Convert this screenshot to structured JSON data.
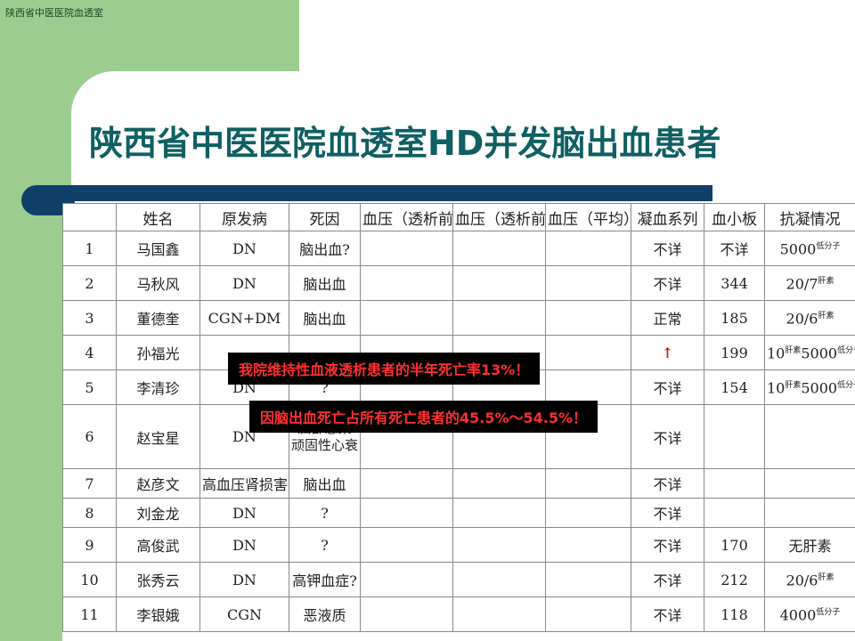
{
  "header": {
    "org": "陕西省中医医院血透室"
  },
  "title": "陕西省中医医院血透室HD并发脑出血患者",
  "table": {
    "columns": [
      "",
      "姓名",
      "原发病",
      "死因",
      "血压（透析前）",
      "血压（透析前）",
      "血压（平均）",
      "凝血系列",
      "血小板",
      "抗凝情况"
    ],
    "rows": [
      {
        "no": "1",
        "name": "马国鑫",
        "disease": "DN",
        "cause": "脑出血?",
        "coag": "不详",
        "plt": "不详",
        "anti": "5000",
        "anti_sup": "低分子"
      },
      {
        "no": "2",
        "name": "马秋风",
        "disease": "DN",
        "cause": "脑出血",
        "coag": "不详",
        "plt": "344",
        "anti": "20/7",
        "anti_sup": "肝素"
      },
      {
        "no": "3",
        "name": "董德奎",
        "disease": "CGN+DM",
        "cause": "脑出血",
        "coag": "正常",
        "plt": "185",
        "anti": "20/6",
        "anti_sup": "肝素"
      },
      {
        "no": "4",
        "name": "孙福光",
        "disease": "",
        "cause": "",
        "coag": "",
        "plt": "199",
        "anti": "10",
        "anti_sup": "肝素",
        "anti2": "5000",
        "anti2_sup": "低分子"
      },
      {
        "no": "5",
        "name": "李清珍",
        "disease": "DN",
        "cause": "?",
        "coag": "不详",
        "plt": "154",
        "anti": "10",
        "anti_sup": "肝素",
        "anti2": "5000",
        "anti2_sup": "低分子"
      },
      {
        "no": "6",
        "name": "赵宝星",
        "disease": "DN",
        "cause": "脑部感染",
        "cause2": "顽固性心衰",
        "coag": "不详",
        "plt": "",
        "anti": ""
      },
      {
        "no": "7",
        "name": "赵彦文",
        "disease": "高血压肾损害",
        "cause": "脑出血",
        "coag": "不详",
        "plt": "",
        "anti": ""
      },
      {
        "no": "8",
        "name": "刘金龙",
        "disease": "DN",
        "cause": "?",
        "coag": "不详",
        "plt": "",
        "anti": ""
      },
      {
        "no": "9",
        "name": "高俊武",
        "disease": "DN",
        "cause": "?",
        "coag": "不详",
        "plt": "170",
        "anti": "无肝素"
      },
      {
        "no": "10",
        "name": "张秀云",
        "disease": "DN",
        "cause": "高钾血症?",
        "coag": "不详",
        "plt": "212",
        "anti": "20/6",
        "anti_sup": "肝素"
      },
      {
        "no": "11",
        "name": "李银娥",
        "disease": "CGN",
        "cause": "恶液质",
        "coag": "不详",
        "plt": "118",
        "anti": "4000",
        "anti_sup": "低分子"
      }
    ],
    "arrow": "↑"
  },
  "callouts": {
    "mortality": "我院维持性血液透析患者的半年死亡率13%！",
    "brain_hemorrhage": "因脑出血死亡占所有死亡患者的45.5%～54.5%！"
  },
  "colors": {
    "green": "#9ccc8f",
    "title": "#0f5f63",
    "bar": "#0f3f69",
    "callout_text": "#ff3030"
  }
}
